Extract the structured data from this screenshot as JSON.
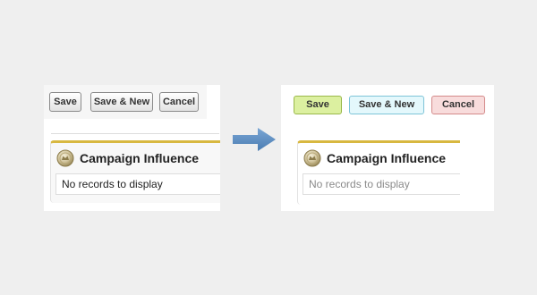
{
  "before": {
    "buttons": {
      "save": "Save",
      "save_new": "Save & New",
      "cancel": "Cancel"
    },
    "card": {
      "title": "Campaign Influence",
      "empty_message": "No records to display"
    }
  },
  "after": {
    "buttons": {
      "save": "Save",
      "save_new": "Save & New",
      "cancel": "Cancel"
    },
    "card": {
      "title": "Campaign Influence",
      "empty_message": "No records to display"
    }
  },
  "icons": {
    "card_icon": "coin-icon",
    "transition": "arrow-right-icon"
  },
  "colors": {
    "background": "#efefef",
    "card_accent": "#d8b840",
    "save_button": "#dcf0a0",
    "save_new_button": "#e4f8fc",
    "cancel_button": "#f8dcdc",
    "arrow": "#5b8cc0"
  }
}
